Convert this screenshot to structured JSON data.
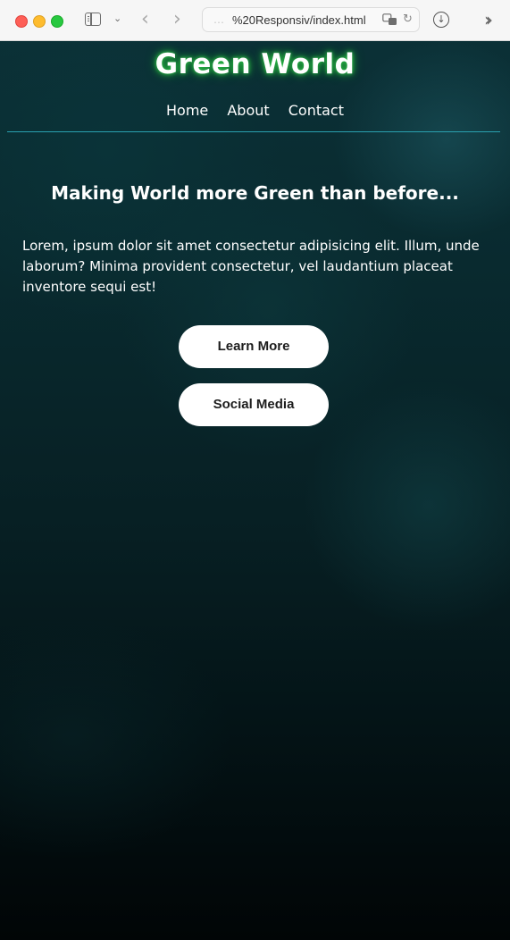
{
  "browser": {
    "url_prefix": "…",
    "url": "%20Responsiv/index.html"
  },
  "site": {
    "title": "Green World",
    "nav": [
      "Home",
      "About",
      "Contact"
    ]
  },
  "hero": {
    "headline": "Making World more Green than before...",
    "body": "Lorem, ipsum dolor sit amet consectetur adipisicing elit. Illum, unde laborum? Minima provident consectetur, vel laudantium placeat inventore sequi est!",
    "buttons": {
      "learn_more": "Learn More",
      "social_media": "Social Media"
    }
  },
  "colors": {
    "title_glow": "#1f9d3a",
    "divider": "#2aa1b0",
    "button_bg": "#ffffff"
  }
}
